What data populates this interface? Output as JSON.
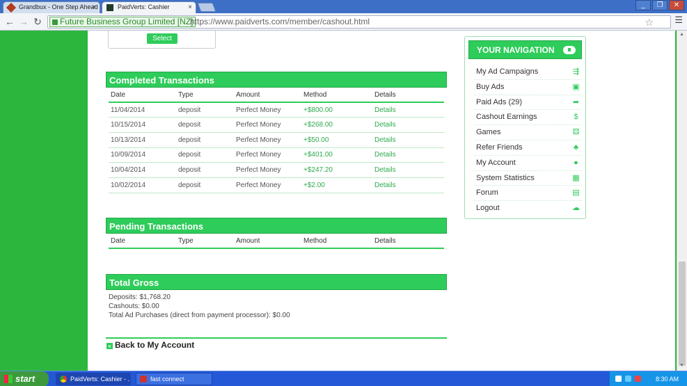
{
  "browser": {
    "tabs": [
      {
        "title": "Grandbux - One Step Ahead",
        "active": false
      },
      {
        "title": "PaidVerts: Cashier",
        "active": true
      }
    ],
    "close_glyph": "×",
    "secure_label": "Future Business Group Limited [NZ]",
    "url": "https://www.paidverts.com/member/cashout.html",
    "window_controls": [
      "_",
      "❐",
      "✕"
    ],
    "nav_glyphs": {
      "back": "←",
      "forward": "→",
      "reload": "↻"
    }
  },
  "select_button": "Select",
  "completed": {
    "title": "Completed Transactions",
    "columns": [
      "Date",
      "Type",
      "Amount",
      "Method",
      "Details"
    ],
    "rows": [
      {
        "date": "11/04/2014",
        "type": "deposit",
        "method": "Perfect Money",
        "amount": "+$800.00",
        "details": "Details"
      },
      {
        "date": "10/15/2014",
        "type": "deposit",
        "method": "Perfect Money",
        "amount": "+$268.00",
        "details": "Details"
      },
      {
        "date": "10/13/2014",
        "type": "deposit",
        "method": "Perfect Money",
        "amount": "+$50.00",
        "details": "Details"
      },
      {
        "date": "10/09/2014",
        "type": "deposit",
        "method": "Perfect Money",
        "amount": "+$401.00",
        "details": "Details"
      },
      {
        "date": "10/04/2014",
        "type": "deposit",
        "method": "Perfect Money",
        "amount": "+$247.20",
        "details": "Details"
      },
      {
        "date": "10/02/2014",
        "type": "deposit",
        "method": "Perfect Money",
        "amount": "+$2.00",
        "details": "Details"
      }
    ]
  },
  "pending": {
    "title": "Pending Transactions",
    "columns": [
      "Date",
      "Type",
      "Amount",
      "Method",
      "Details"
    ]
  },
  "gross": {
    "title": "Total Gross",
    "deposits": "Deposits: $1,768.20",
    "cashouts": "Cashouts: $0.00",
    "ad_purchases": "Total Ad Purchases (direct from payment processor): $0.00"
  },
  "back_link": "Back to My Account",
  "navigation": {
    "title": "YOUR NAVIGATION",
    "items": [
      {
        "label": "My Ad Campaigns",
        "icon": "share-icon",
        "glyph": "⇶"
      },
      {
        "label": "Buy Ads",
        "icon": "money-icon",
        "glyph": "▣"
      },
      {
        "label": "Paid Ads (29)",
        "icon": "forward-icon",
        "glyph": "➦"
      },
      {
        "label": "Cashout Earnings",
        "icon": "moneybag-icon",
        "glyph": "$"
      },
      {
        "label": "Games",
        "icon": "dice-icon",
        "glyph": "⚄"
      },
      {
        "label": "Refer Friends",
        "icon": "network-icon",
        "glyph": "♣"
      },
      {
        "label": "My Account",
        "icon": "user-icon",
        "glyph": "●"
      },
      {
        "label": "System Statistics",
        "icon": "chart-icon",
        "glyph": "▦"
      },
      {
        "label": "Forum",
        "icon": "book-icon",
        "glyph": "▤"
      },
      {
        "label": "Logout",
        "icon": "cloud-icon",
        "glyph": "☁"
      }
    ]
  },
  "taskbar": {
    "start": "start",
    "tasks": [
      "PaidVerts: Cashier - ...",
      "fast connect"
    ],
    "clock": "8:30 AM"
  },
  "colors": {
    "accent": "#2ecc5a",
    "desktop": "#2db63e",
    "taskbar": "#2458d6"
  }
}
